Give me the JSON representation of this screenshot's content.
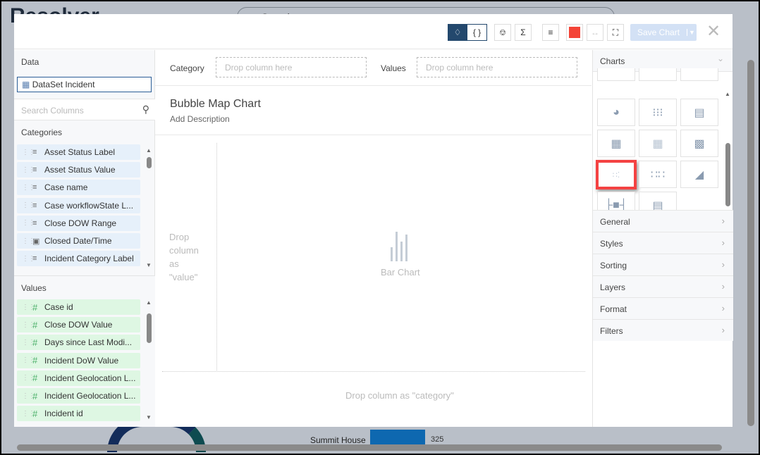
{
  "background": {
    "logo": "Resolver",
    "search_placeholder": "Search",
    "bar_label": "Summit House",
    "bar_value": "325"
  },
  "toolbar": {
    "save_label": "Save Chart",
    "color_swatch": "#f44336"
  },
  "data_panel": {
    "title": "Data",
    "dataset": "DataSet Incident",
    "search_placeholder": "Search Columns",
    "categories_title": "Categories",
    "categories": [
      {
        "label": "Asset Status Label",
        "icon": "text"
      },
      {
        "label": "Asset Status Value",
        "icon": "text"
      },
      {
        "label": "Case name",
        "icon": "text"
      },
      {
        "label": "Case workflowState L...",
        "icon": "text"
      },
      {
        "label": "Close DOW Range",
        "icon": "text"
      },
      {
        "label": "Closed Date/Time",
        "icon": "calendar"
      },
      {
        "label": "Incident Category Label",
        "icon": "text"
      }
    ],
    "values_title": "Values",
    "values": [
      "Case id",
      "Close DOW Value",
      "Days since Last Modi...",
      "Incident DoW Value",
      "Incident Geolocation L...",
      "Incident Geolocation L...",
      "Incident id"
    ]
  },
  "canvas": {
    "category_label": "Category",
    "values_label": "Values",
    "drop_placeholder": "Drop column here",
    "chart_title": "Bubble Map Chart",
    "description": "Add Description",
    "drop_value": "Drop column as \"value\"",
    "placeholder_chart": "Bar Chart",
    "drop_category": "Drop column as \"category\""
  },
  "charts_panel": {
    "title": "Charts",
    "selected": "bubble-map",
    "sections": [
      "General",
      "Styles",
      "Sorting",
      "Layers",
      "Format",
      "Filters"
    ]
  }
}
